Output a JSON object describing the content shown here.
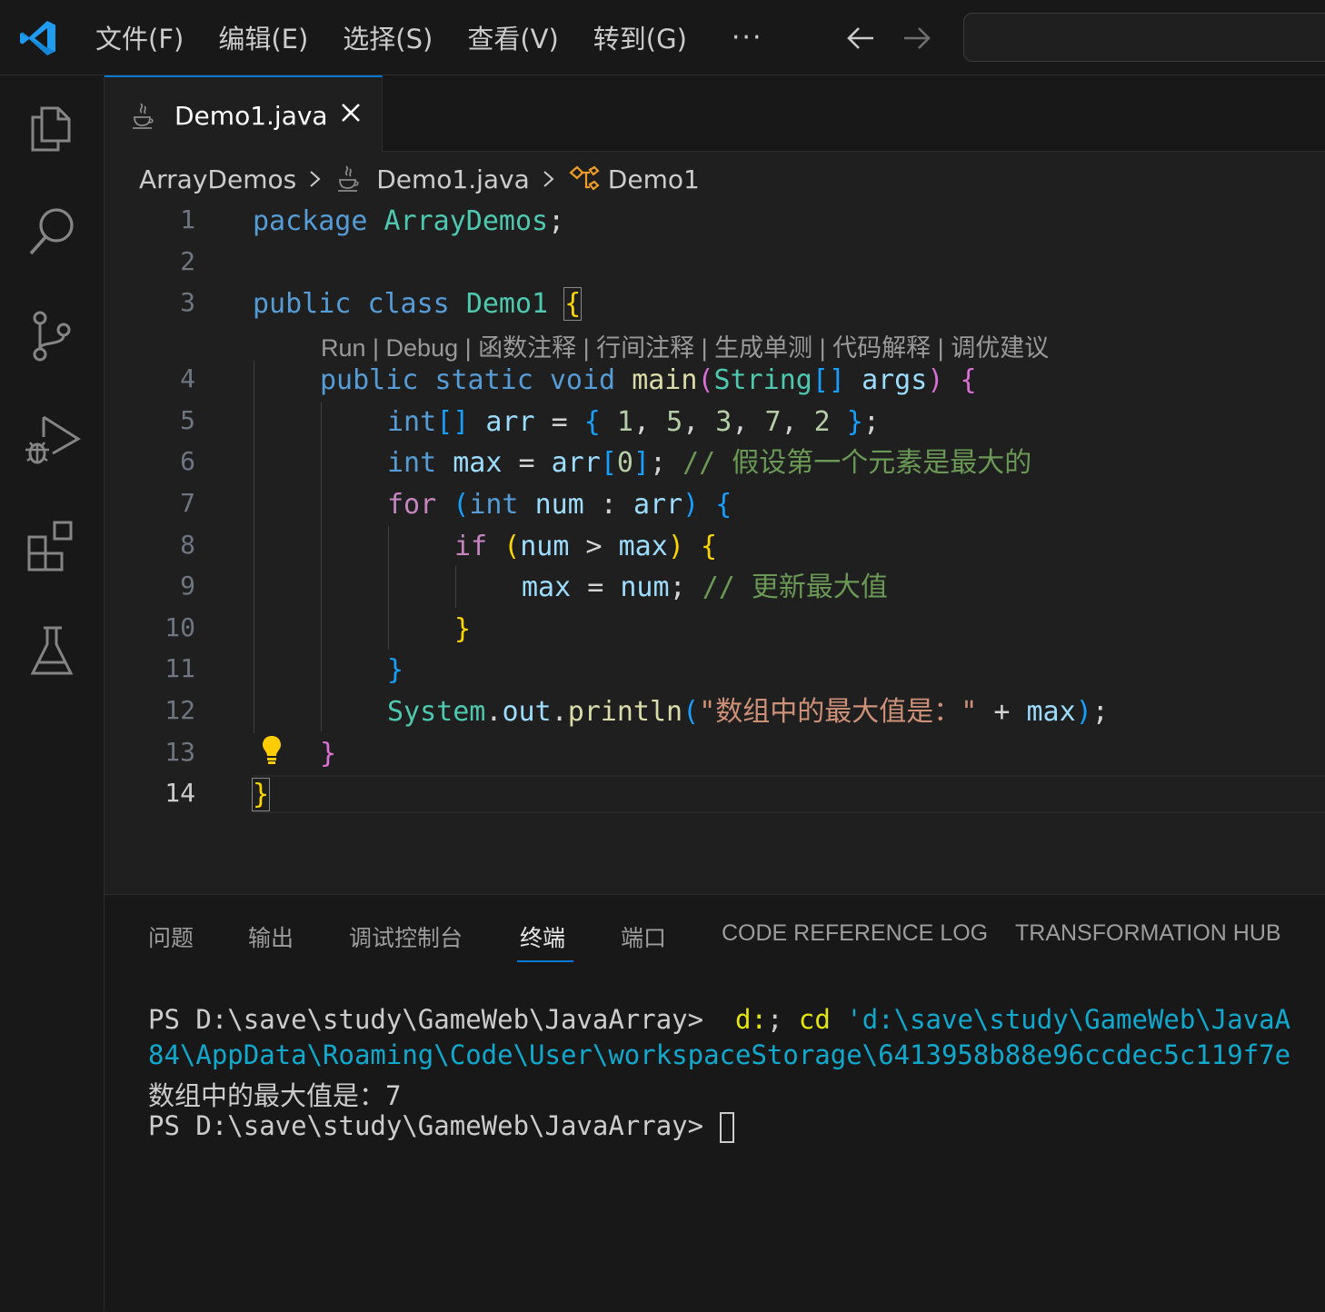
{
  "menu": {
    "file": "文件(F)",
    "edit": "编辑(E)",
    "select": "选择(S)",
    "view": "查看(V)",
    "goto": "转到(G)",
    "more": "···"
  },
  "tab": {
    "label": "Demo1.java"
  },
  "breadcrumb": {
    "folder": "ArrayDemos",
    "file": "Demo1.java",
    "symbol": "Demo1"
  },
  "codelens": "Run | Debug | 函数注释 | 行间注释 | 生成单测 | 代码解释 | 调优建议",
  "line_numbers": [
    "1",
    "2",
    "3",
    "4",
    "5",
    "6",
    "7",
    "8",
    "9",
    "10",
    "11",
    "12",
    "13",
    "14"
  ],
  "code": {
    "l1": {
      "kw": "package",
      "name": "ArrayDemos",
      "end": ";"
    },
    "l3": {
      "kw1": "public",
      "kw2": "class",
      "name": "Demo1",
      "brace": "{"
    },
    "l4": {
      "kw1": "public",
      "kw2": "static",
      "kw3": "void",
      "fn": "main",
      "type": "String",
      "arr": "[]",
      "arg": "args",
      "open": "(",
      "close": ")",
      "brace": "{"
    },
    "l5": {
      "type": "int",
      "arr": "[]",
      "var": "arr",
      "eq": " = ",
      "open": "{",
      "n1": "1",
      "n2": "5",
      "n3": "3",
      "n4": "7",
      "n5": "2",
      "close": "}",
      "end": ";"
    },
    "l6": {
      "type": "int",
      "var": "max",
      "eq": " = ",
      "ref": "arr",
      "open": "[",
      "idx": "0",
      "close": "]",
      "end": ";",
      "comment": "// 假设第一个元素是最大的"
    },
    "l7": {
      "kw": "for",
      "open": "(",
      "type": "int",
      "var": "num",
      "colon": " : ",
      "ref": "arr",
      "close": ")",
      "brace": "{"
    },
    "l8": {
      "kw": "if",
      "open": "(",
      "a": "num",
      "op": " > ",
      "b": "max",
      "close": ")",
      "brace": "{"
    },
    "l9": {
      "a": "max",
      "eq": " = ",
      "b": "num",
      "end": ";",
      "comment": "// 更新最大值"
    },
    "l10": {
      "brace": "}"
    },
    "l11": {
      "brace": "}"
    },
    "l12": {
      "cls": "System",
      "dot1": ".",
      "field": "out",
      "dot2": ".",
      "fn": "println",
      "open": "(",
      "str": "\"数组中的最大值是：\"",
      "plus": " + ",
      "var": "max",
      "close": ")",
      "end": ";"
    },
    "l13": {
      "brace": "}"
    },
    "l14": {
      "brace": "}"
    }
  },
  "panel": {
    "tabs": [
      "问题",
      "输出",
      "调试控制台",
      "终端",
      "端口",
      "CODE REFERENCE LOG",
      "TRANSFORMATION HUB"
    ],
    "active_tab": "终端"
  },
  "terminal": {
    "line1_prompt": "PS D:\\save\\study\\GameWeb\\JavaArray> ",
    "line1_cmd1": " d:",
    "line1_sep": "; ",
    "line1_cmd2": "cd",
    "line1_path": " 'd:\\save\\study\\GameWeb\\JavaA",
    "line2": "84\\AppData\\Roaming\\Code\\User\\workspaceStorage\\6413958b88e96ccdec5c119f7e",
    "line3": "数组中的最大值是：7",
    "line4_prompt": "PS D:\\save\\study\\GameWeb\\JavaArray> "
  },
  "colors": {
    "accent": "#0078d4",
    "keyword": "#569cd6",
    "control": "#c586c0",
    "type": "#4ec9b0",
    "variable": "#9cdcfe",
    "function": "#dcdcaa",
    "number": "#b5cea8",
    "string": "#ce9178",
    "comment": "#6a9955"
  }
}
